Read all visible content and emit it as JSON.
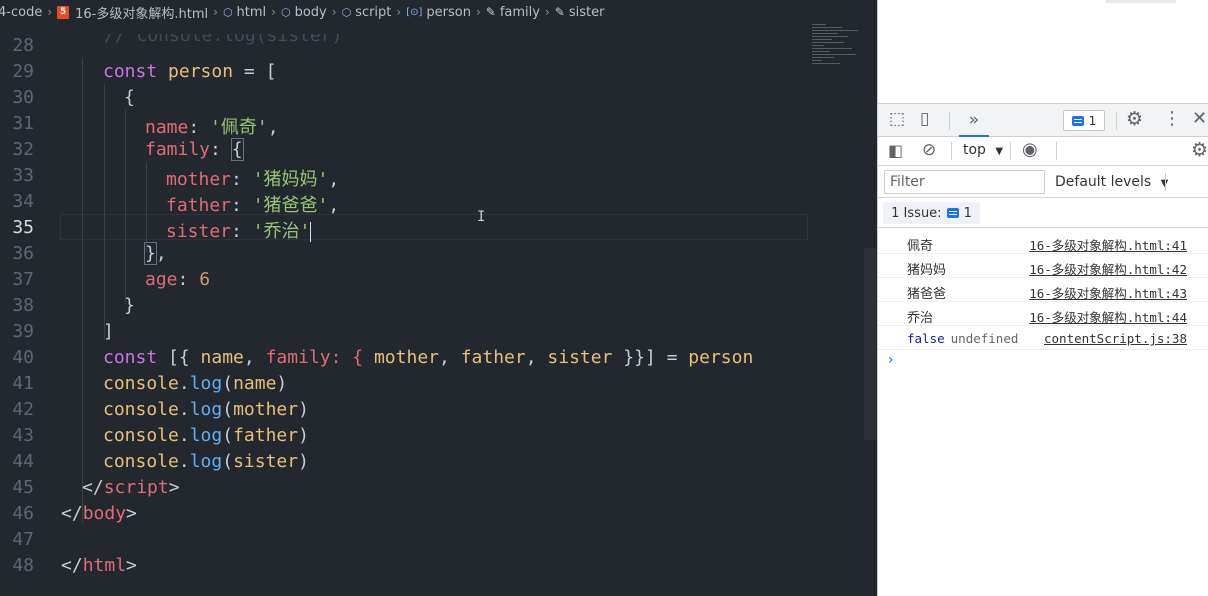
{
  "breadcrumb": {
    "items": [
      {
        "label": "4-code",
        "icon": "folder-icon"
      },
      {
        "label": "16-多级对象解构.html",
        "icon": "html5-icon"
      },
      {
        "label": "html",
        "icon": "element-icon"
      },
      {
        "label": "body",
        "icon": "element-icon"
      },
      {
        "label": "script",
        "icon": "element-icon"
      },
      {
        "label": "person",
        "icon": "variable-icon"
      },
      {
        "label": "family",
        "icon": "wrench-icon"
      },
      {
        "label": "sister",
        "icon": "wrench-icon"
      }
    ],
    "html5_glyph": "5"
  },
  "editor": {
    "partial_top_line": "// console.log(sister)",
    "active_line": "35",
    "line_numbers": [
      "28",
      "29",
      "30",
      "31",
      "32",
      "33",
      "34",
      "35",
      "36",
      "37",
      "38",
      "39",
      "40",
      "41",
      "42",
      "43",
      "44",
      "45",
      "46",
      "47",
      "48"
    ],
    "tokens": {
      "const": "const",
      "person": "person",
      "eq": " = ",
      "open_bracket": "[",
      "open_brace": "{",
      "name": "name",
      "colon": ": ",
      "name_val": "'佩奇'",
      "comma": ",",
      "family": "family",
      "mother": "mother",
      "mother_val": "'猪妈妈'",
      "father": "father",
      "father_val": "'猪爸爸'",
      "sister": "sister",
      "sister_val": "'乔治'",
      "close_brace_comma": "},",
      "age": "age",
      "age_val": "6",
      "close_brace": "}",
      "close_bracket": "]",
      "destructure_open": " [{ ",
      "destructure_family": "family: { ",
      "destructure_sep": ", ",
      "destructure_close": " }}] = ",
      "console": "console",
      "dot": ".",
      "log": "log",
      "lparen": "(",
      "rparen": ")",
      "lt": "<",
      "lt_slash": "</",
      "gt": ">",
      "script": "script",
      "body": "body",
      "html": "html"
    },
    "accent_colors": {
      "keyword": "#c678dd",
      "variable": "#e5c07b",
      "property": "#e06c75",
      "string": "#98c379",
      "number": "#d19a66",
      "function": "#61afef"
    }
  },
  "devtools": {
    "tabs_overflow": "»",
    "issues_count": "1",
    "context": "top",
    "filter_placeholder": "Filter",
    "levels_label": "Default levels",
    "issues_bar_label": "1 Issue:",
    "issues_bar_count": "1",
    "console_rows": [
      {
        "message": "佩奇",
        "source": "16-多级对象解构.html:41"
      },
      {
        "message": "猪妈妈",
        "source": "16-多级对象解构.html:42"
      },
      {
        "message": "猪爸爸",
        "source": "16-多级对象解构.html:43"
      },
      {
        "message": "乔治",
        "source": "16-多级对象解构.html:44"
      }
    ],
    "last_row": {
      "value1": "false",
      "value2": "undefined",
      "source": "contentScript.js:38"
    },
    "prompt": "›"
  }
}
